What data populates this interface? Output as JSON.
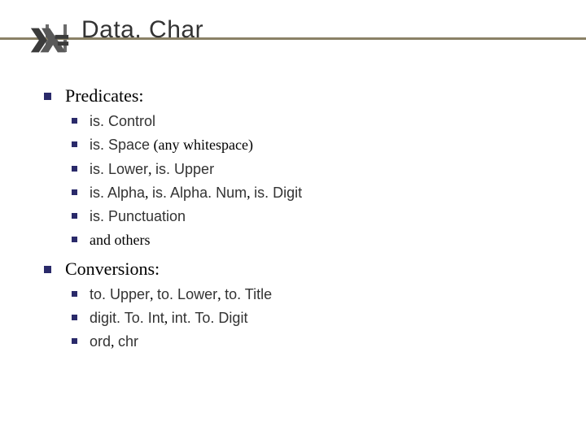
{
  "title": "Data. Char",
  "sections": [
    {
      "heading": "Predicates:",
      "items": [
        {
          "code": "is. Control"
        },
        {
          "code": "is. Space",
          "suffix": " (any whitespace)"
        },
        {
          "parts": [
            {
              "t": "code",
              "v": "is. Lower"
            },
            {
              "t": "plain",
              "v": ", "
            },
            {
              "t": "code",
              "v": "is. Upper"
            }
          ]
        },
        {
          "parts": [
            {
              "t": "code",
              "v": "is. Alpha"
            },
            {
              "t": "plain",
              "v": ", "
            },
            {
              "t": "code",
              "v": "is. Alpha. Num"
            },
            {
              "t": "plain",
              "v": ", "
            },
            {
              "t": "code",
              "v": "is. Digit"
            }
          ]
        },
        {
          "code": "is. Punctuation"
        },
        {
          "plain": "and others"
        }
      ]
    },
    {
      "heading": "Conversions:",
      "items": [
        {
          "parts": [
            {
              "t": "code",
              "v": "to. Upper"
            },
            {
              "t": "plain",
              "v": ", "
            },
            {
              "t": "code",
              "v": "to. Lower"
            },
            {
              "t": "plain",
              "v": ", "
            },
            {
              "t": "code",
              "v": "to. Title"
            }
          ]
        },
        {
          "parts": [
            {
              "t": "code",
              "v": "digit. To. Int"
            },
            {
              "t": "plain",
              "v": ", "
            },
            {
              "t": "code",
              "v": "int. To. Digit"
            }
          ]
        },
        {
          "parts": [
            {
              "t": "code",
              "v": "ord"
            },
            {
              "t": "plain",
              "v": ", "
            },
            {
              "t": "code",
              "v": "chr"
            }
          ]
        }
      ]
    }
  ]
}
